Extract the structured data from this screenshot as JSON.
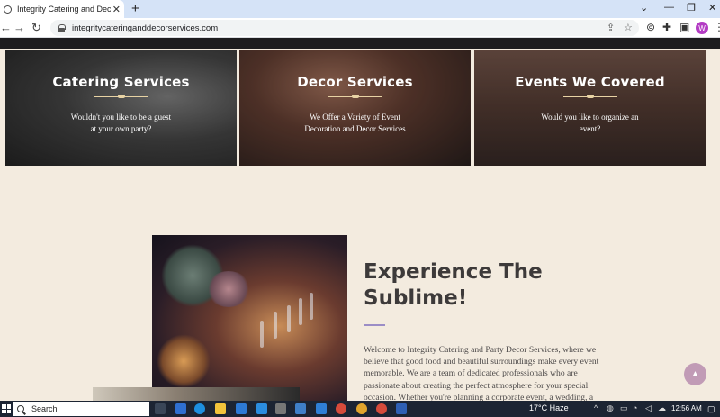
{
  "browser": {
    "tab_title": "Integrity Catering and Decor Se",
    "url": "integritycateringanddecorservices.com",
    "profile_initial": "W"
  },
  "cards": [
    {
      "title": "Catering Services",
      "line1": "Wouldn't you like to be a guest",
      "line2": "at your own party?"
    },
    {
      "title": "Decor Services",
      "line1": "We Offer a Variety of Event",
      "line2": "Decoration and Decor Services"
    },
    {
      "title": "Events We Covered",
      "line1": "Would you like to organize an",
      "line2": "event?"
    }
  ],
  "experience": {
    "title_line1": "Experience The",
    "title_line2": "Sublime!",
    "body_lines": [
      "Welcome to Integrity Catering and Party Decor Services, where we",
      "believe that good food and beautiful surroundings make every event",
      "memorable. We are a team of dedicated professionals who are",
      "passionate about creating the perfect atmosphere for your special",
      "occasion. Whether you're planning a corporate event, a wedding, a"
    ]
  },
  "taskbar": {
    "search_label": "Search",
    "weather": "17°C  Haze",
    "clock": "12:56 AM"
  },
  "colors": {
    "page_bg": "#f3ebdf",
    "accent_rule": "#9b8dc6",
    "scroll_button": "#c19bb6",
    "tab_strip": "#d5e3f7",
    "taskbar": "#1c2433"
  }
}
